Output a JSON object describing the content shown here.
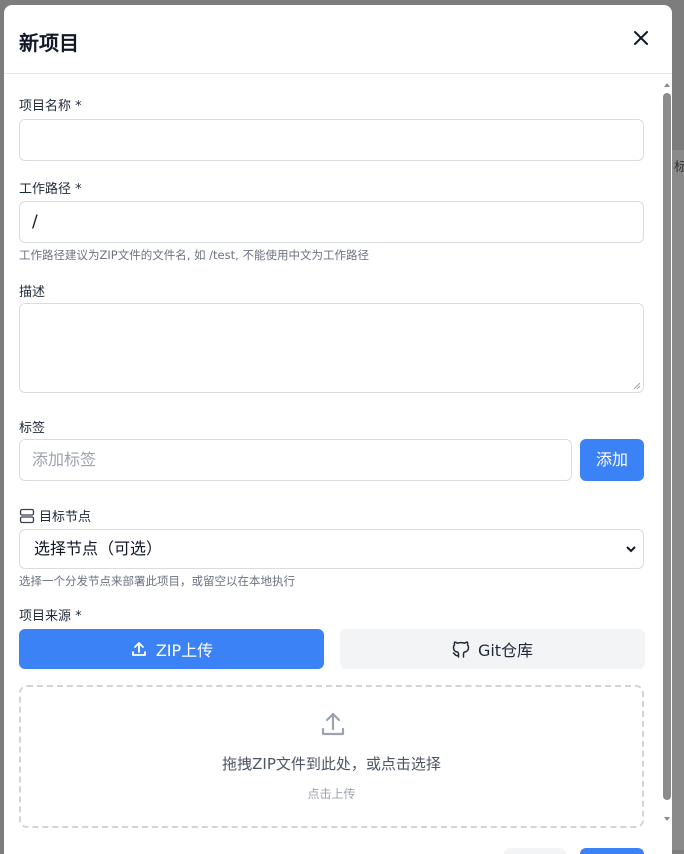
{
  "modal": {
    "title": "新项目"
  },
  "form": {
    "name_label": "项目名称 *",
    "name_value": "",
    "path_label": "工作路径 *",
    "path_value": "/",
    "path_hint": "工作路径建议为ZIP文件的文件名, 如 /test, 不能使用中文为工作路径",
    "desc_label": "描述",
    "tags_label": "标签",
    "tags_placeholder": "添加标签",
    "tags_add": "添加",
    "node_label": "目标节点",
    "node_selected": "选择节点（可选）",
    "node_hint": "选择一个分发节点来部署此项目，或留空以在本地执行",
    "source_label": "项目来源 *",
    "source_zip": "ZIP上传",
    "source_git": "Git仓库",
    "dropzone_text": "拖拽ZIP文件到此处，或点击选择",
    "dropzone_sub": "点击上传"
  },
  "background": {
    "peek_char": "标"
  },
  "colors": {
    "primary": "#3b82f6",
    "border": "#d9dde3",
    "hint": "#6b7280"
  }
}
